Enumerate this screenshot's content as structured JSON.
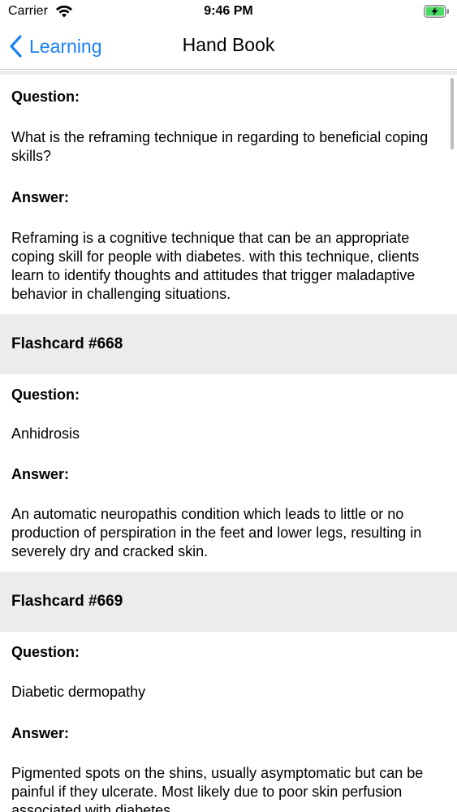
{
  "status_bar": {
    "carrier": "Carrier",
    "time": "9:46 PM"
  },
  "nav": {
    "back_label": "Learning",
    "title": "Hand Book",
    "accent_color": "#1a82f7"
  },
  "labels": {
    "question": "Question:",
    "answer": "Answer:"
  },
  "cards": [
    {
      "title": "",
      "question": "What is the reframing technique in regarding to beneficial coping skills?",
      "answer": "Reframing is a cognitive technique that can be an appropriate coping skill for people with diabetes. with this technique, clients learn to identify thoughts and attitudes that trigger maladaptive behavior in challenging situations."
    },
    {
      "title": "Flashcard #668",
      "question": "Anhidrosis",
      "answer": "An automatic neuropathis condition which leads to little or no production of perspiration in the feet and lower legs, resulting in severely dry and cracked skin."
    },
    {
      "title": "Flashcard #669",
      "question": "Diabetic dermopathy",
      "answer": "Pigmented spots on the shins, usually asymptomatic but can be painful if they ulcerate. Most likely due to poor skin perfusion associated with diabetes."
    }
  ]
}
